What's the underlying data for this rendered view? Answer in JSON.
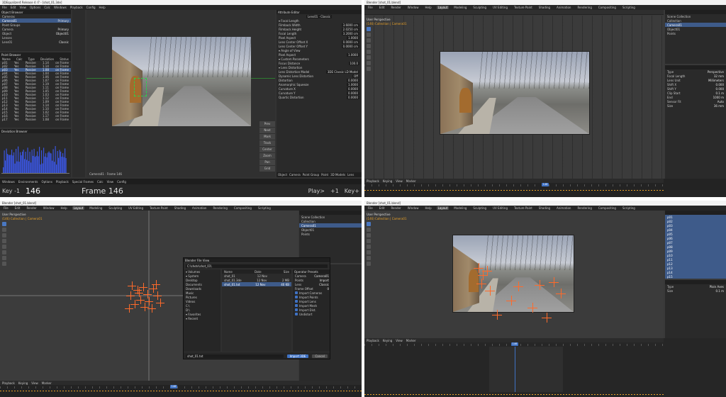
{
  "q1": {
    "window_title": "3DEqualizer4 Release 4 r7 - [shot_01.3de]",
    "menus": [
      "File",
      "Edit",
      "View",
      "Options",
      "Calc",
      "Windows",
      "Playback",
      "Config",
      "Help"
    ],
    "object_browser": {
      "title": "Object Browser",
      "menus": [
        "Edit",
        "View",
        "Config"
      ],
      "items": [
        {
          "label": "Cameras",
          "value": ""
        },
        {
          "label": "Camera01",
          "value": "Primary"
        },
        {
          "label": "Point Groups",
          "value": ""
        },
        {
          "label": "Camera",
          "value": "Primary"
        },
        {
          "label": "Object",
          "value": "Object01"
        },
        {
          "label": "Lenses",
          "value": ""
        },
        {
          "label": "Lens01",
          "value": "Classic"
        }
      ]
    },
    "point_browser": {
      "title": "Point Browser",
      "menus": [
        "Edit",
        "View",
        "Config"
      ],
      "columns": [
        "Name",
        "Calc",
        "Type",
        "Deviation",
        "Status"
      ],
      "rows": [
        [
          "p01",
          "Yes",
          "Passive",
          "1.14",
          "on Frame"
        ],
        [
          "p02",
          "Yes",
          "Passive",
          "1.14",
          "on Frame"
        ],
        [
          "p03",
          "Yes",
          "Passive",
          "1.08",
          "on Frame"
        ],
        [
          "p04",
          "Yes",
          "Passive",
          "1.04",
          "on Frame"
        ],
        [
          "p05",
          "Yes",
          "Passive",
          "1.06",
          "on Frame"
        ],
        [
          "p06",
          "Yes",
          "Passive",
          "1.07",
          "on Frame"
        ],
        [
          "p07",
          "Yes",
          "Passive",
          "1.19",
          "on Frame"
        ],
        [
          "p08",
          "Yes",
          "Passive",
          "1.11",
          "on Frame"
        ],
        [
          "p09",
          "Yes",
          "Passive",
          "1.05",
          "on Frame"
        ],
        [
          "p10",
          "Yes",
          "Passive",
          "1.03",
          "on Frame"
        ],
        [
          "p11",
          "Yes",
          "Passive",
          "1.12",
          "on Frame"
        ],
        [
          "p12",
          "Yes",
          "Passive",
          "1.09",
          "on Frame"
        ],
        [
          "p13",
          "Yes",
          "Passive",
          "1.14",
          "on Frame"
        ],
        [
          "p14",
          "Yes",
          "Passive",
          "1.10",
          "on Frame"
        ],
        [
          "p15",
          "Yes",
          "Passive",
          "1.02",
          "on Frame"
        ],
        [
          "p16",
          "Yes",
          "Passive",
          "1.17",
          "on Frame"
        ],
        [
          "p17",
          "Yes",
          "Passive",
          "1.08",
          "on Frame"
        ]
      ]
    },
    "deviation_browser": {
      "title": "Deviation Browser",
      "menus": [
        "Edit",
        "View",
        "Config"
      ]
    },
    "attribute_editor": {
      "title": "Attribute Editor",
      "menus": [
        "Edit",
        "Config"
      ],
      "header": "Lens01 · Classic",
      "sections": [
        {
          "label": "Focal Length",
          "rows": [
            [
              "Filmback Width",
              "3.6000 cm"
            ],
            [
              "Filmback Height",
              "2.0250 cm"
            ],
            [
              "Focal Length",
              "3.2000 cm"
            ],
            [
              "Pixel Aspect",
              "1.0000"
            ],
            [
              "Lens Center Offset X",
              "0.0000 cm"
            ],
            [
              "Lens Center Offset Y",
              "0.0000 cm"
            ]
          ]
        },
        {
          "label": "Angle of View",
          "rows": [
            [
              "Pixel Aspect",
              "1.0000"
            ]
          ]
        },
        {
          "label": "Custom Parameters",
          "rows": [
            [
              "Focus Distance",
              "100.0"
            ]
          ]
        },
        {
          "label": "Lens Distortion",
          "rows": [
            [
              "Lens Distortion Model",
              "3DE Classic LD Model"
            ],
            [
              "Dynamic Lens Distortion",
              "Off"
            ],
            [
              "Distortion",
              "0.0000"
            ],
            [
              "Anamorphic Squeeze",
              "1.0000"
            ],
            [
              "Curvature X",
              "0.0000"
            ],
            [
              "Curvature Y",
              "0.0000"
            ],
            [
              "Quartic Distortion",
              "0.0000"
            ]
          ]
        }
      ],
      "bottom_tabs": [
        "Object",
        "Camera",
        "Point Group",
        "Point",
        "3D Models",
        "Lens"
      ]
    },
    "side_buttons": [
      "Prev",
      "Next",
      "Mark",
      "Track",
      "Center",
      "Zoom",
      "Pan",
      "Grid"
    ],
    "viewport_status": "Camera01 · Frame 146",
    "footer": {
      "key_label": "Key",
      "key_step": "-1",
      "frame_number": "146",
      "frame_caption": "Frame 146",
      "play_label": "Play>",
      "play_step": "+1",
      "key_next": "Key+",
      "menus": [
        "Windows",
        "Environments",
        "Options",
        "Playback",
        "Special Frames",
        "Calc",
        "View",
        "Config"
      ]
    }
  },
  "q2": {
    "window_title": "Blender [shot_01.blend]",
    "menus": [
      "File",
      "Edit",
      "Render",
      "Window",
      "Help"
    ],
    "workspace_tabs": [
      "Layout",
      "Modeling",
      "Sculpting",
      "UV Editing",
      "Texture Paint",
      "Shading",
      "Animation",
      "Rendering",
      "Compositing",
      "Scripting"
    ],
    "active_tab": "Layout",
    "view_label": "User Perspective",
    "collection_label": "(146) Collection | Camera01",
    "outliner": [
      "Scene Collection",
      "Collection",
      "Camera01",
      "Object01",
      "Points"
    ],
    "properties_rows": [
      [
        "Type",
        "Perspective"
      ],
      [
        "Focal Length",
        "32 mm"
      ],
      [
        "Lens Unit",
        "Millimeters"
      ],
      [
        "Shift X",
        "0.000"
      ],
      [
        "Shift Y",
        "0.000"
      ],
      [
        "Clip Start",
        "0.1 m"
      ],
      [
        "End",
        "1000 m"
      ],
      [
        "Sensor Fit",
        "Auto"
      ],
      [
        "Size",
        "36 mm"
      ]
    ],
    "timeline_menus": [
      "Playback",
      "Keying",
      "View",
      "Marker"
    ],
    "current_frame": "146"
  },
  "q3": {
    "window_title": "Blender [shot_01.blend]",
    "menus": [
      "File",
      "Edit",
      "Render",
      "Window",
      "Help"
    ],
    "workspace_tabs": [
      "Layout",
      "Modeling",
      "Sculpting",
      "UV Editing",
      "Texture Paint",
      "Shading",
      "Animation",
      "Rendering",
      "Compositing",
      "Scripting"
    ],
    "active_tab": "Layout",
    "view_label": "User Perspective",
    "collection_label": "(146) Collection | Camera01",
    "outliner": [
      "Scene Collection",
      "Collection",
      "Camera01",
      "Object01",
      "Points"
    ],
    "file_browser": {
      "title": "Blender File View",
      "path": "C:\\shots\\shot_01\\",
      "sidebar_sections": [
        "Volumes",
        "System",
        "Favorites",
        "Recent"
      ],
      "sidebar_items": [
        "Desktop",
        "Documents",
        "Downloads",
        "Music",
        "Pictures",
        "Videos",
        "C:\\",
        "D:\\"
      ],
      "columns": [
        "Name",
        "Date",
        "Size"
      ],
      "files": [
        [
          "shot_01",
          "12 Nov",
          ""
        ],
        [
          "shot_01.3de",
          "12 Nov",
          "2 MB"
        ],
        [
          "shot_01.txt",
          "12 Nov",
          "40 KB"
        ]
      ],
      "options_title": "Operator Presets",
      "options": [
        [
          "Camera",
          "Camera01"
        ],
        [
          "Points",
          "Import"
        ],
        [
          "Lens",
          "Classic"
        ],
        [
          "Frame Offset",
          "0"
        ]
      ],
      "checks": [
        "Import Cameras",
        "Import Points",
        "Import Lens",
        "Import Mesh",
        "Import Dist.",
        "Undistort"
      ],
      "filename": "shot_01.txt",
      "import_label": "Import 3DE",
      "cancel_label": "Cancel"
    },
    "timeline_menus": [
      "Playback",
      "Keying",
      "View",
      "Marker"
    ],
    "current_frame": "146"
  },
  "q4": {
    "window_title": "Blender [shot_01.blend]",
    "menus": [
      "File",
      "Edit",
      "Render",
      "Window",
      "Help"
    ],
    "workspace_tabs": [
      "Layout",
      "Modeling",
      "Sculpting",
      "UV Editing",
      "Texture Paint",
      "Shading",
      "Animation",
      "Rendering",
      "Compositing",
      "Scripting"
    ],
    "active_tab": "Layout",
    "view_label": "User Perspective",
    "collection_label": "(146) Collection | Camera01",
    "outliner": [
      "p01",
      "p02",
      "p03",
      "p04",
      "p05",
      "p06",
      "p07",
      "p08",
      "p09",
      "p10",
      "p11",
      "p12",
      "p13",
      "p14",
      "p15"
    ],
    "properties_rows": [
      [
        "Type",
        "Plain Axes"
      ],
      [
        "Size",
        "0.1 m"
      ]
    ],
    "timeline_menus": [
      "Playback",
      "Keying",
      "View",
      "Marker"
    ],
    "current_frame": "146"
  },
  "colors": {
    "accent": "#3f72c4",
    "tracker": "#ff6a2a",
    "keyframe": "#e8a028",
    "selection": "#3e5b8a"
  }
}
